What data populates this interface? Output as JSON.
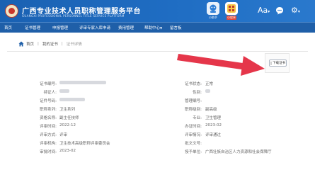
{
  "header": {
    "title": "广西专业技术人员职称管理服务平台",
    "subtitle": "GUANGXI PROFESSIONAL PERSONNEL TITLE SERVICE PLATFORM",
    "icons": [
      {
        "name": "assistant-icon",
        "caption": "小助手"
      },
      {
        "name": "mini-program-icon",
        "caption": "小程序"
      }
    ],
    "tools": {
      "font_size": "Aa",
      "chat": "chat-icon",
      "settings": "gear-icon"
    }
  },
  "nav": {
    "items": [
      "首页",
      "证书管理",
      "申报管理",
      "评审专家入库申请",
      "费用管理",
      "帮助中心",
      "留言板"
    ]
  },
  "breadcrumb": {
    "home": "首页",
    "section": "我的证书",
    "current": "证书详情"
  },
  "download_button": {
    "label": "下载证书",
    "icon": "download-icon"
  },
  "details": {
    "left": [
      {
        "label": "证书编号:",
        "value": "",
        "masked": true
      },
      {
        "label": "持证人:",
        "value": "",
        "masked": true
      },
      {
        "label": "证件号码:",
        "value": "",
        "masked": true
      },
      {
        "label": "职称系列:",
        "value": "卫生系列"
      },
      {
        "label": "资格名称:",
        "value": "副主任技师"
      },
      {
        "label": "评审时间:",
        "value": "2022-12"
      },
      {
        "label": "评审方式:",
        "value": "评审"
      },
      {
        "label": "评审机构:",
        "value": "卫生技术高级职称评审委员会"
      },
      {
        "label": "审批时间:",
        "value": "2023-02"
      }
    ],
    "right": [
      {
        "label": "证书状态:",
        "value": "正常"
      },
      {
        "label": "性别:",
        "value": "",
        "masked": true
      },
      {
        "label": "管理编号:",
        "value": ""
      },
      {
        "label": "职称级别:",
        "value": "副高级"
      },
      {
        "label": "专业:",
        "value": "卫生管理"
      },
      {
        "label": "办证时间:",
        "value": "2023-02"
      },
      {
        "label": "评审情况:",
        "value": "评审通过"
      },
      {
        "label": "批文文号:",
        "value": ""
      },
      {
        "label": "授予单位:",
        "value": "广西壮族自治区人力资源和社会保障厅"
      }
    ]
  },
  "colors": {
    "header_bg": "#1f6dc3",
    "nav_bg": "#1f5fa8",
    "arrow": "#e5364a"
  }
}
